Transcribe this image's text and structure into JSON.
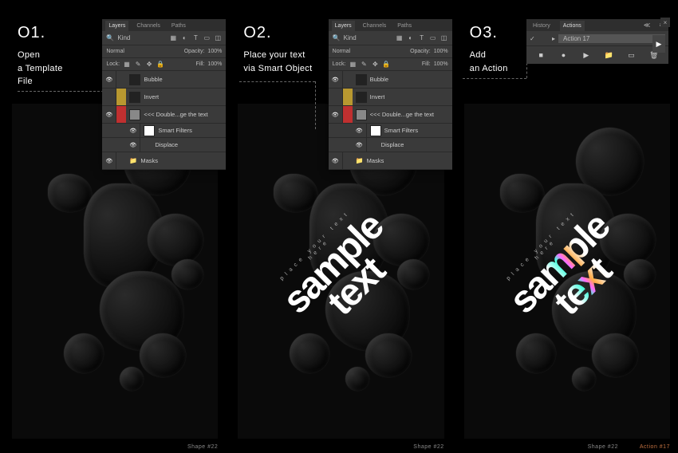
{
  "steps": [
    {
      "number": "O1.",
      "title_line1": "Open",
      "title_line2": "a Template",
      "title_line3": "File"
    },
    {
      "number": "O2.",
      "title_line1": "Place your text",
      "title_line2": "via Smart Object",
      "title_line3": ""
    },
    {
      "number": "O3.",
      "title_line1": "Add",
      "title_line2": "an Action",
      "title_line3": ""
    }
  ],
  "layers_panel": {
    "tabs": {
      "layers": "Layers",
      "channels": "Channels",
      "paths": "Paths"
    },
    "search_label": "Kind",
    "blend_mode": "Normal",
    "opacity_label": "Opacity:",
    "opacity_value": "100%",
    "lock_label": "Lock:",
    "fill_label": "Fill:",
    "fill_value": "100%",
    "layers": [
      {
        "name": "Bubble",
        "color": "",
        "thumb": "dark"
      },
      {
        "name": "Invert",
        "color": "#b89830",
        "thumb": "dark"
      },
      {
        "name": "<<< Double...ge the text",
        "color": "#c03030",
        "thumb": "light"
      },
      {
        "name": "Smart Filters",
        "sub": true
      },
      {
        "name": "Displace",
        "sub": true,
        "eye": true
      },
      {
        "name": "Masks",
        "folder": true
      }
    ]
  },
  "actions_panel": {
    "tabs": {
      "history": "History",
      "actions": "Actions"
    },
    "action_name": "Action 17",
    "close": "×"
  },
  "sample": {
    "small": "place your text here",
    "line1": "sample",
    "line2": "text"
  },
  "captions": {
    "shape": "Shape #22",
    "action": "Action #17"
  }
}
